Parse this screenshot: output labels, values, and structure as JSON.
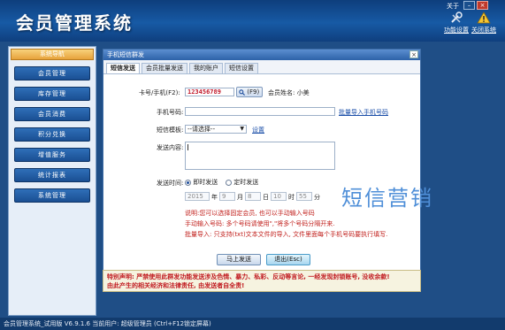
{
  "header": {
    "title": "会员管理系统",
    "about": "关于",
    "window_buttons": [
      "–",
      "×"
    ],
    "tools": [
      {
        "label": "功能设置",
        "icon": "tools-icon"
      },
      {
        "label": "关闭系统",
        "icon": "warning-icon"
      }
    ]
  },
  "sidebar": {
    "heading": "系统导航",
    "items": [
      "会员管理",
      "库存管理",
      "会员消费",
      "积分兑换",
      "增值服务",
      "统计报表",
      "系统管理"
    ]
  },
  "dialog": {
    "title": "手机短信群发",
    "close": "×",
    "tabs": [
      "短信发送",
      "会员批量发送",
      "我的账户",
      "短信设置"
    ],
    "active_tab": "短信发送",
    "form": {
      "card_label": "卡号/手机(F2):",
      "card_value": "123456789",
      "f9_button": "(F9)",
      "member_name": "会员姓名: 小美",
      "phone_label": "手机号码:",
      "import_link": "批量导入手机号码",
      "template_label": "短信模板:",
      "template_value": "--请选择--",
      "settings_link": "设置",
      "content_label": "发送内容:",
      "time_label": "发送时间:",
      "send_now": "即时发送",
      "send_scheduled": "定时发送",
      "date": {
        "year": "2015",
        "year_unit": "年",
        "month": "9",
        "month_unit": "月",
        "day": "8",
        "day_unit": "日",
        "hour": "10",
        "hour_unit": "时",
        "minute": "55",
        "minute_unit": "分"
      },
      "notes": [
        "说明:您可以选择固定会员, 也可以手动输入号码",
        "手动输入号码: 多个号码请使用\",\"将多个号码分隔开来.",
        "批量导入: 只支持(txt)文本文件的导入, 文件里面每个手机号码要执行填写."
      ],
      "send_button": "马上发送",
      "exit_button": "退出(Esc)"
    }
  },
  "watermark": "短信营销",
  "disclaimer": [
    "特别声明: 严禁使用此群发功能发送涉及色情、暴力、私彩、反动等言论, 一经发现封锁账号, 没收余款!",
    "由此产生的相关经济和法律责任, 由发送者自全责!"
  ],
  "statusbar": "会员管理系统_试用版 V6.9.1.6 当前用户: 超级管理员 (Ctrl+F12锁定屏幕)"
}
